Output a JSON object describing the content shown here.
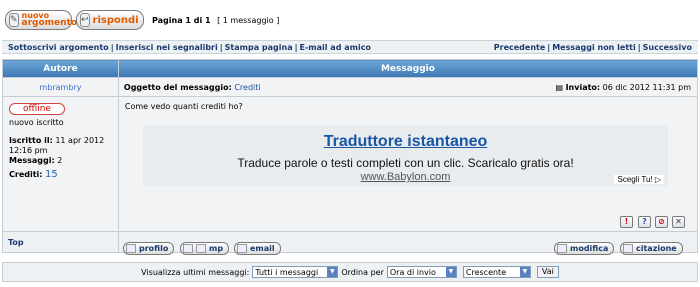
{
  "toolbar": {
    "new_topic_line1": "nuovo",
    "new_topic_line2": "argomento",
    "reply_label": "rispondi",
    "page_info": "Pagina 1 di 1",
    "message_count": "[ 1 messaggio ]"
  },
  "linkbar": {
    "left": [
      "Sottoscrivi argomento",
      "Inserisci nei segnalibri",
      "Stampa pagina",
      "E-mail ad amico"
    ],
    "right": [
      "Precedente",
      "Messaggi non letti",
      "Successivo"
    ]
  },
  "table": {
    "col_author": "Autore",
    "col_message": "Messaggio"
  },
  "post": {
    "author": "mbrambry",
    "subject_label": "Oggetto del messaggio:",
    "subject": "Crediti",
    "sent_label": "Inviato:",
    "sent_date": "06 dic 2012 11:31 pm",
    "status": "offline",
    "rank": "nuovo iscritto",
    "joined_label": "Iscritto il:",
    "joined_value": "11 apr 2012 12:16 pm",
    "messages_label": "Messaggi:",
    "messages_value": "2",
    "credits_label": "Crediti:",
    "credits_value": "15",
    "body": "Come vedo quanti crediti ho?"
  },
  "ad": {
    "title": "Traduttore istantaneo",
    "description": "Traduce parole o testi completi con un clic. Scaricalo gratis ora!",
    "url": "www.Babylon.com",
    "choice": "Scegli Tu! ▷"
  },
  "post_actions": {
    "top": "Top",
    "profile": "profilo",
    "pm": "mp",
    "email": "email",
    "edit": "modifica",
    "quote": "citazione"
  },
  "bottom": {
    "show_label": "Visualizza ultimi messaggi:",
    "show_value": "Tutti i messaggi",
    "order_label": "Ordina per",
    "order_value": "Ora di invio",
    "direction_value": "Crescente",
    "go": "Vai"
  },
  "colors": {
    "header_blue": "#3b77b3",
    "link_blue": "#1a3a6e",
    "accent_orange": "#e05a00"
  }
}
